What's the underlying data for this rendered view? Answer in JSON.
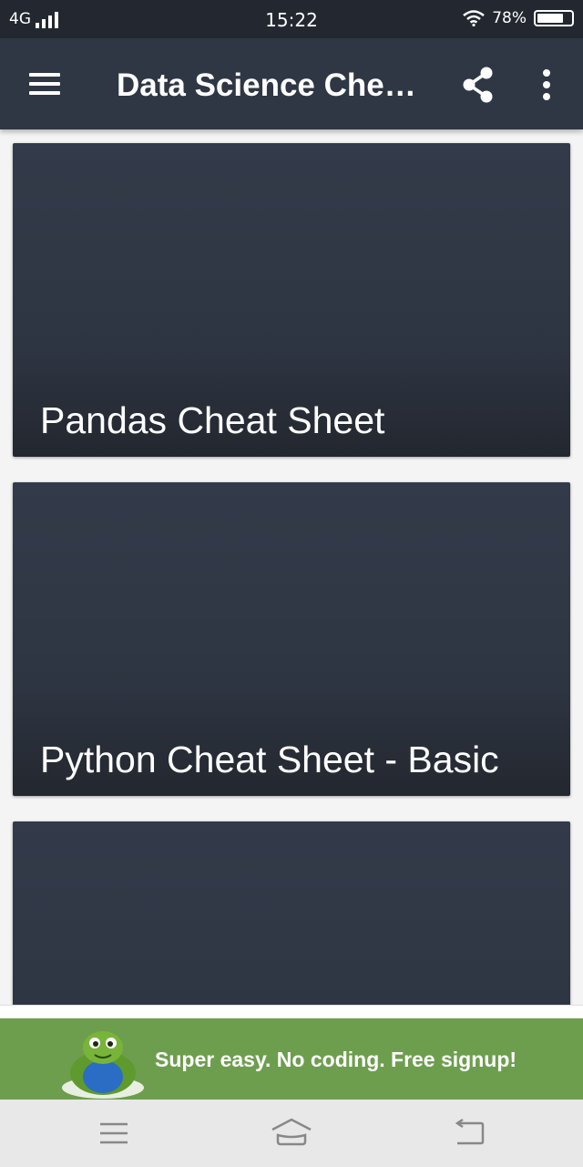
{
  "status_bar": {
    "network": "4G",
    "time": "15:22",
    "battery_percent": "78%",
    "battery_level": 0.78
  },
  "app_bar": {
    "title": "Data Science Cheat…",
    "icons": {
      "menu": "hamburger-menu-icon",
      "share": "share-icon",
      "more": "more-vert-icon"
    }
  },
  "cards": [
    {
      "title": "Pandas Cheat Sheet"
    },
    {
      "title": "Python Cheat Sheet - Basic"
    },
    {
      "title": ""
    }
  ],
  "ad": {
    "text": "Super easy. No coding. Free signup!"
  },
  "nav_bar": {
    "icons": [
      "recent-apps-icon",
      "home-icon",
      "back-icon"
    ]
  },
  "colors": {
    "app_bar": "#2f3644",
    "status_bar": "#232830",
    "card": "#2e3542",
    "ad_background": "#6d9e4e",
    "page_background": "#f4f4f4"
  }
}
